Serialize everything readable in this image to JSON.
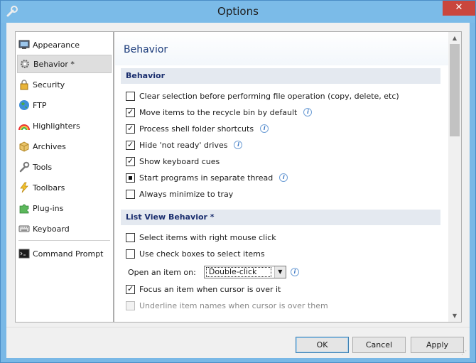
{
  "window": {
    "title": "Options",
    "close_label": "✕"
  },
  "nav": {
    "items": [
      {
        "label": "Appearance",
        "icon": "monitor-icon"
      },
      {
        "label": "Behavior *",
        "icon": "gears-icon",
        "selected": true
      },
      {
        "label": "Security",
        "icon": "lock-icon"
      },
      {
        "label": "FTP",
        "icon": "globe-icon"
      },
      {
        "label": "Highlighters",
        "icon": "rainbow-icon"
      },
      {
        "label": "Archives",
        "icon": "box-icon"
      },
      {
        "label": "Tools",
        "icon": "wrench-icon"
      },
      {
        "label": "Toolbars",
        "icon": "lightning-icon"
      },
      {
        "label": "Plug-ins",
        "icon": "puzzle-icon"
      },
      {
        "label": "Keyboard",
        "icon": "keyboard-icon"
      }
    ],
    "extra_item": {
      "label": "Command Prompt",
      "icon": "console-icon"
    }
  },
  "content": {
    "page_title": "Behavior",
    "behavior_section": {
      "header": "Behavior",
      "options": [
        {
          "label": "Clear selection before performing file operation (copy, delete, etc)",
          "state": "unchecked",
          "info": false
        },
        {
          "label": "Move items to the recycle bin by default",
          "state": "checked",
          "info": true
        },
        {
          "label": "Process shell folder shortcuts",
          "state": "checked",
          "info": true
        },
        {
          "label": "Hide 'not ready' drives",
          "state": "checked",
          "info": true
        },
        {
          "label": "Show keyboard cues",
          "state": "checked",
          "info": false
        },
        {
          "label": "Start programs in separate thread",
          "state": "indeterminate",
          "info": true
        },
        {
          "label": "Always minimize to tray",
          "state": "unchecked",
          "info": false
        }
      ]
    },
    "listview_section": {
      "header": "List View Behavior *",
      "options_top": [
        {
          "label": "Select items with right mouse click",
          "state": "unchecked"
        },
        {
          "label": "Use check boxes to select items",
          "state": "unchecked"
        }
      ],
      "open_item": {
        "label": "Open an item on:",
        "value": "Double-click"
      },
      "options_bottom": [
        {
          "label": "Focus an item when cursor is over it",
          "state": "checked",
          "disabled": false
        },
        {
          "label": "Underline item names when cursor is over them",
          "state": "unchecked",
          "disabled": true
        }
      ]
    }
  },
  "buttons": {
    "ok": "OK",
    "cancel": "Cancel",
    "apply": "Apply"
  },
  "colors": {
    "titlebar": "#7bbbe8",
    "close": "#c9463d",
    "section_header": "#e4e9f0",
    "title_text": "#1a3a7a"
  }
}
